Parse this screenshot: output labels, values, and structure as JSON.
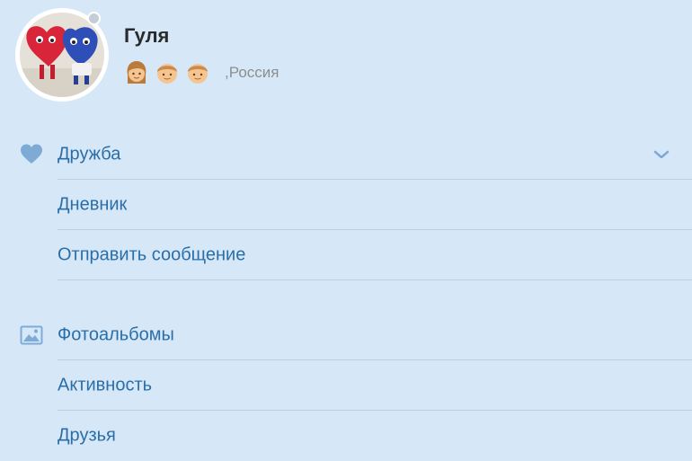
{
  "profile": {
    "name": "Гуля",
    "location": ",Россия",
    "status_emoji": [
      "girl-emoji",
      "boy-emoji",
      "boy-emoji"
    ],
    "avatar": "avatar-photo",
    "online_indicator": "offline"
  },
  "menu_group_1": {
    "items": [
      {
        "label": "Дружба",
        "icon": "heart-icon",
        "has_dropdown": true
      },
      {
        "label": "Дневник",
        "icon": null,
        "has_dropdown": false
      },
      {
        "label": "Отправить сообщение",
        "icon": null,
        "has_dropdown": false
      }
    ]
  },
  "menu_group_2": {
    "items": [
      {
        "label": "Фотоальбомы",
        "icon": "photo-icon"
      },
      {
        "label": "Активность",
        "icon": null
      },
      {
        "label": "Друзья",
        "icon": null
      }
    ]
  },
  "colors": {
    "background": "#d6e8f8",
    "link": "#2b6ea7",
    "icon": "#7eabd6",
    "separator": "#b9cfe2",
    "name": "#2a2a2a",
    "location": "#8e8e8e"
  }
}
